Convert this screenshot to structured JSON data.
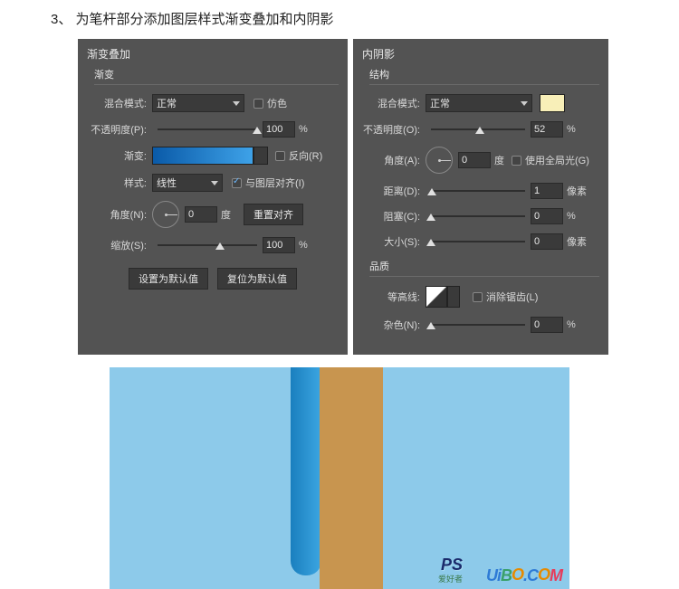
{
  "step": {
    "number": "3、",
    "title": "为笔杆部分添加图层样式渐变叠加和内阴影"
  },
  "gradient_overlay": {
    "panel_title": "渐变叠加",
    "section": "渐变",
    "blend_mode_label": "混合模式:",
    "blend_mode_value": "正常",
    "dither_label": "仿色",
    "opacity_label": "不透明度(P):",
    "opacity_value": "100",
    "opacity_unit": "%",
    "gradient_label": "渐变:",
    "reverse_label": "反向(R)",
    "style_label": "样式:",
    "style_value": "线性",
    "align_label": "与图层对齐(I)",
    "angle_label": "角度(N):",
    "angle_value": "0",
    "angle_unit": "度",
    "reset_align_btn": "重置对齐",
    "scale_label": "缩放(S):",
    "scale_value": "100",
    "scale_unit": "%",
    "default_btn": "设置为默认值",
    "reset_btn": "复位为默认值",
    "gradient_colors": [
      "#0a5aa8",
      "#3ea2e8"
    ]
  },
  "inner_shadow": {
    "panel_title": "内阴影",
    "section_struct": "结构",
    "blend_mode_label": "混合模式:",
    "blend_mode_value": "正常",
    "swatch_color": "#f8efb8",
    "opacity_label": "不透明度(O):",
    "opacity_value": "52",
    "opacity_unit": "%",
    "angle_label": "角度(A):",
    "angle_value": "0",
    "angle_unit": "度",
    "global_light_label": "使用全局光(G)",
    "distance_label": "距离(D):",
    "distance_value": "1",
    "distance_unit": "像素",
    "choke_label": "阻塞(C):",
    "choke_value": "0",
    "choke_unit": "%",
    "size_label": "大小(S):",
    "size_value": "0",
    "size_unit": "像素",
    "section_quality": "品质",
    "contour_label": "等高线:",
    "antialias_label": "消除锯齿(L)",
    "noise_label": "杂色(N):",
    "noise_value": "0",
    "noise_unit": "%"
  },
  "watermark": {
    "ps": "PS",
    "sub": "爱好者",
    "text": "UiBO.COM"
  }
}
